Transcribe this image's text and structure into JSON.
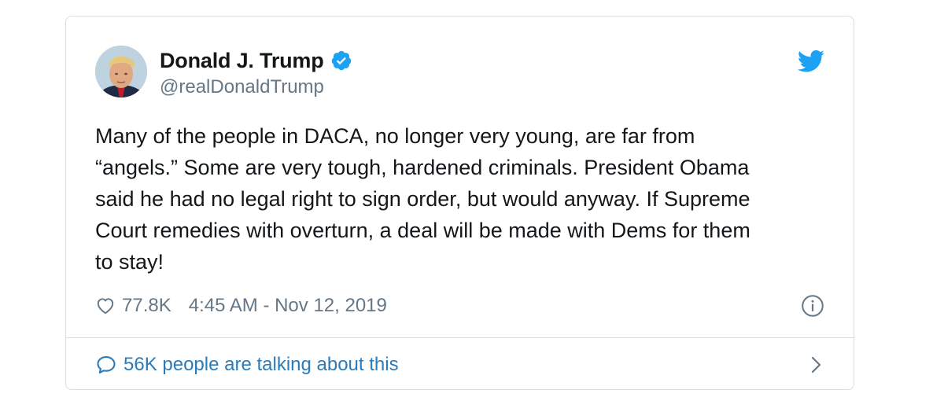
{
  "tweet": {
    "author": {
      "display_name": "Donald J. Trump",
      "handle": "@realDonaldTrump",
      "verified": true
    },
    "text": "Many of the people in DACA, no longer very young, are far from\n“angels.” Some are very tough, hardened criminals. President Obama\nsaid he had no legal right to sign order, but would anyway. If Supreme\nCourt remedies with overturn, a deal will be made with Dems for them\nto stay!",
    "like_count": "77.8K",
    "timestamp": "4:45 AM - Nov 12, 2019",
    "conversation_text": "56K people are talking about this"
  },
  "icons": {
    "brand": "twitter-bird-icon",
    "verified": "verified-badge-icon",
    "like": "heart-icon",
    "info": "info-icon",
    "reply": "speech-bubble-icon",
    "chevron": "chevron-right-icon"
  },
  "colors": {
    "twitter_blue": "#1da1f2",
    "link_blue": "#2b7bb9",
    "text_primary": "#14171a",
    "text_secondary": "#657786",
    "border": "#d8dee3"
  }
}
